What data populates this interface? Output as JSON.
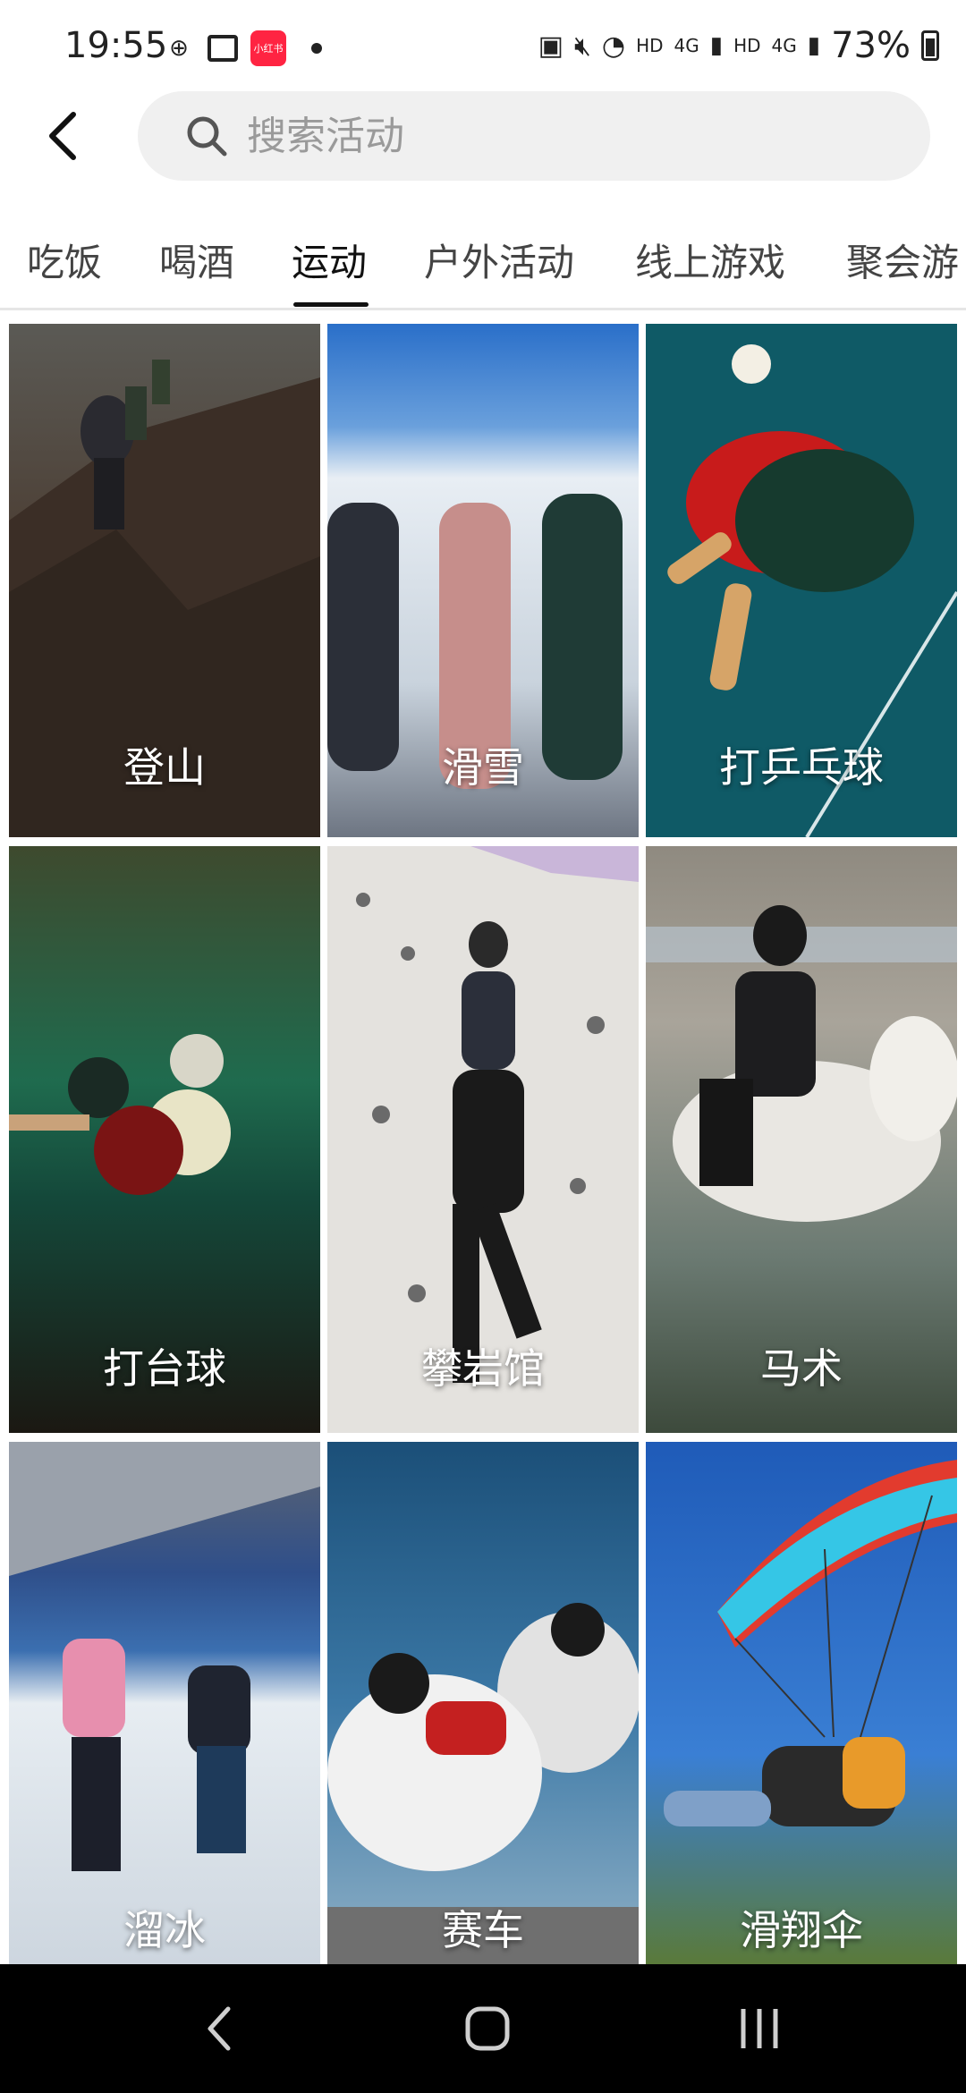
{
  "status_bar": {
    "time": "19:55",
    "app_badge": "小红书",
    "network_labels": [
      "HD",
      "4G",
      "HD",
      "4G"
    ],
    "battery": "73%"
  },
  "search": {
    "placeholder": "搜索活动"
  },
  "tabs": [
    {
      "label": "吃饭",
      "active": false
    },
    {
      "label": "喝酒",
      "active": false
    },
    {
      "label": "运动",
      "active": true
    },
    {
      "label": "户外活动",
      "active": false
    },
    {
      "label": "线上游戏",
      "active": false
    },
    {
      "label": "聚会游",
      "active": false
    }
  ],
  "activities": [
    {
      "label": "登山"
    },
    {
      "label": "滑雪"
    },
    {
      "label": "打乒乓球"
    },
    {
      "label": "打台球"
    },
    {
      "label": "攀岩馆"
    },
    {
      "label": "马术"
    },
    {
      "label": "溜冰"
    },
    {
      "label": "赛车"
    },
    {
      "label": "滑翔伞"
    }
  ],
  "colors": {
    "brand": "#ff2442",
    "tab_active": "#111111",
    "tab_inactive": "#444444",
    "search_bg": "#f0f0f0"
  }
}
